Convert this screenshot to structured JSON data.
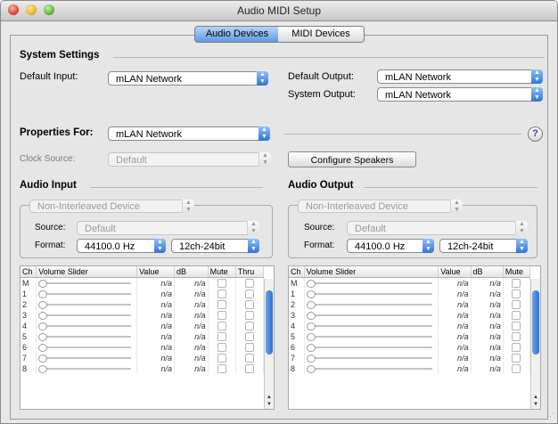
{
  "window": {
    "title": "Audio MIDI Setup"
  },
  "tabs": [
    {
      "label": "Audio Devices",
      "selected": true
    },
    {
      "label": "MIDI Devices",
      "selected": false
    }
  ],
  "system": {
    "heading": "System Settings",
    "default_input_label": "Default Input:",
    "default_input_value": "mLAN Network",
    "default_output_label": "Default Output:",
    "default_output_value": "mLAN Network",
    "system_output_label": "System Output:",
    "system_output_value": "mLAN Network"
  },
  "properties": {
    "label": "Properties For:",
    "value": "mLAN Network",
    "help_glyph": "?",
    "clock_source_label": "Clock Source:",
    "clock_source_value": "Default",
    "configure_speakers": "Configure Speakers"
  },
  "audio_input": {
    "heading": "Audio Input",
    "device_mode": "Non-Interleaved Device",
    "source_label": "Source:",
    "source_value": "Default",
    "format_label": "Format:",
    "format_rate": "44100.0 Hz",
    "format_bits": "12ch-24bit",
    "columns": [
      "Ch",
      "Volume Slider",
      "Value",
      "dB",
      "Mute",
      "Thru"
    ],
    "rows": [
      {
        "ch": "M",
        "value": "n/a",
        "db": "n/a"
      },
      {
        "ch": "1",
        "value": "n/a",
        "db": "n/a"
      },
      {
        "ch": "2",
        "value": "n/a",
        "db": "n/a"
      },
      {
        "ch": "3",
        "value": "n/a",
        "db": "n/a"
      },
      {
        "ch": "4",
        "value": "n/a",
        "db": "n/a"
      },
      {
        "ch": "5",
        "value": "n/a",
        "db": "n/a"
      },
      {
        "ch": "6",
        "value": "n/a",
        "db": "n/a"
      },
      {
        "ch": "7",
        "value": "n/a",
        "db": "n/a"
      },
      {
        "ch": "8",
        "value": "n/a",
        "db": "n/a"
      }
    ]
  },
  "audio_output": {
    "heading": "Audio Output",
    "device_mode": "Non-Interleaved Device",
    "source_label": "Source:",
    "source_value": "Default",
    "format_label": "Format:",
    "format_rate": "44100.0 Hz",
    "format_bits": "12ch-24bit",
    "columns": [
      "Ch",
      "Volume Slider",
      "Value",
      "dB",
      "Mute"
    ],
    "rows": [
      {
        "ch": "M",
        "value": "n/a",
        "db": "n/a"
      },
      {
        "ch": "1",
        "value": "n/a",
        "db": "n/a"
      },
      {
        "ch": "2",
        "value": "n/a",
        "db": "n/a"
      },
      {
        "ch": "3",
        "value": "n/a",
        "db": "n/a"
      },
      {
        "ch": "4",
        "value": "n/a",
        "db": "n/a"
      },
      {
        "ch": "5",
        "value": "n/a",
        "db": "n/a"
      },
      {
        "ch": "6",
        "value": "n/a",
        "db": "n/a"
      },
      {
        "ch": "7",
        "value": "n/a",
        "db": "n/a"
      },
      {
        "ch": "8",
        "value": "n/a",
        "db": "n/a"
      }
    ]
  },
  "colors": {
    "accent": "#3a7ee0",
    "selected_tab": "#8ab8f0"
  }
}
